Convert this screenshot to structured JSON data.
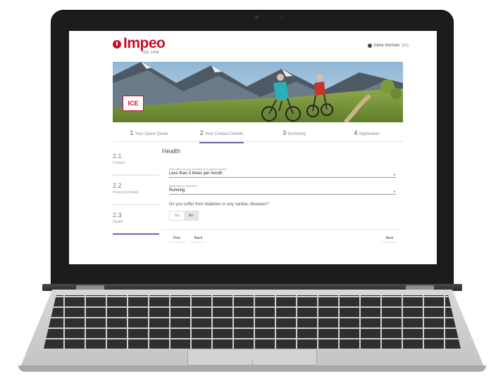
{
  "header": {
    "logo_text": "Impeo",
    "logo_subtitle": "ICE LPM",
    "user": "Irene Vurman",
    "user_extra": "(xx)",
    "accent_color": "#c8102e"
  },
  "banner": {
    "badge": "ICE"
  },
  "steps": [
    {
      "num": "1",
      "label": "Your Quick Quote"
    },
    {
      "num": "2",
      "label": "Your Contact Details"
    },
    {
      "num": "3",
      "label": "Summary"
    },
    {
      "num": "4",
      "label": "Application"
    }
  ],
  "sidebar": [
    {
      "num": "2.1",
      "label": "Contact"
    },
    {
      "num": "2.2",
      "label": "Personal Details"
    },
    {
      "num": "2.3",
      "label": "Health"
    }
  ],
  "form": {
    "title": "Health",
    "field1": {
      "label": "How often do you exercise (in a typical week)?",
      "value": "Less than 3 times per month"
    },
    "field2": {
      "label": "What kind of exercise?",
      "value": "Running"
    },
    "question": "Do you suffer from diabetes or any cardiac diseases?",
    "toggle": {
      "yes": "Yes",
      "no": "No",
      "selected": "No"
    },
    "buttons": {
      "first": "First",
      "back": "Back",
      "next": "Next"
    }
  }
}
